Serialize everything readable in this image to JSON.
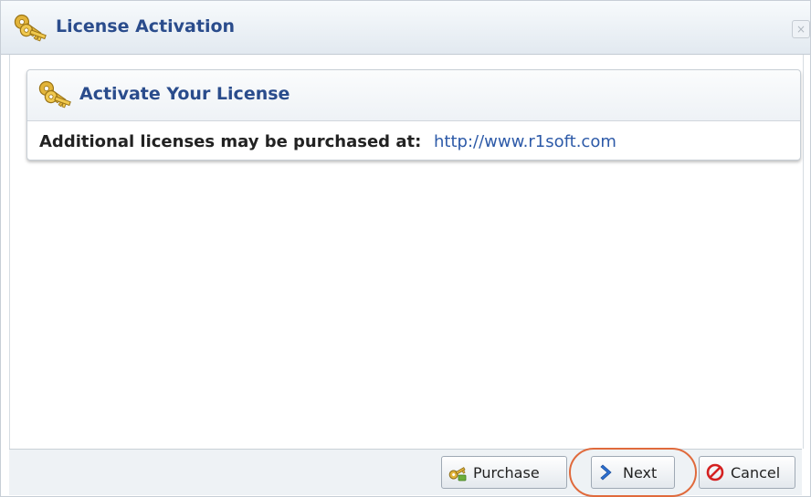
{
  "window": {
    "title": "License Activation",
    "title_icon": "keys-icon",
    "close_label": "×"
  },
  "panel": {
    "title": "Activate Your License",
    "icon": "keys-icon",
    "info_label": "Additional licenses may be purchased at:",
    "info_link": "http://www.r1soft.com"
  },
  "buttons": {
    "purchase": "Purchase",
    "next": "Next",
    "cancel": "Cancel"
  },
  "colors": {
    "title_text": "#2a4c8c",
    "link": "#2d5aa8",
    "highlight_circle": "#e06a3c",
    "key_gold": "#e2b43a"
  }
}
